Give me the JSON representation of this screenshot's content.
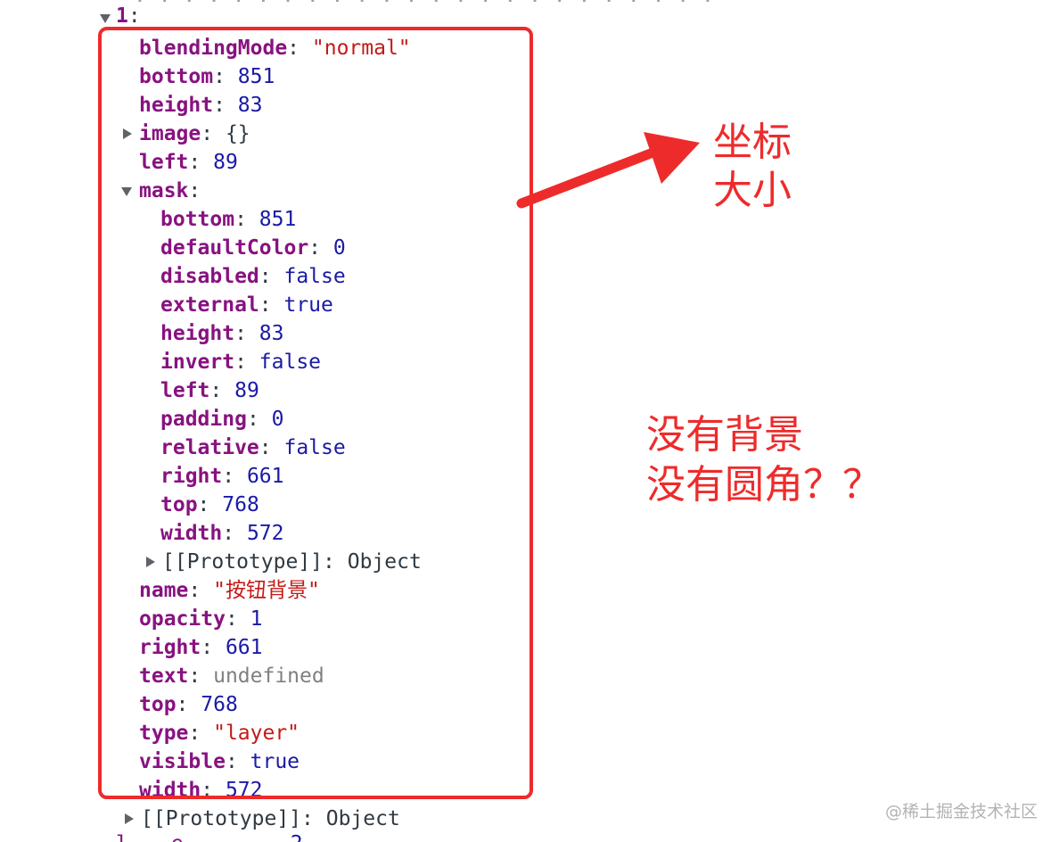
{
  "header_row": {
    "index": "1",
    "colon": ":"
  },
  "properties": [
    {
      "key": "blendingMode",
      "value": "\"normal\"",
      "kind": "str"
    },
    {
      "key": "bottom",
      "value": "851",
      "kind": "num"
    },
    {
      "key": "height",
      "value": "83",
      "kind": "num"
    },
    {
      "key": "image",
      "value": "{}",
      "kind": "plain",
      "expandable": true
    },
    {
      "key": "left",
      "value": "89",
      "kind": "num"
    },
    {
      "key": "mask",
      "value": "",
      "kind": "plain",
      "expanded": true
    }
  ],
  "mask_properties": [
    {
      "key": "bottom",
      "value": "851",
      "kind": "num"
    },
    {
      "key": "defaultColor",
      "value": "0",
      "kind": "num"
    },
    {
      "key": "disabled",
      "value": "false",
      "kind": "bool"
    },
    {
      "key": "external",
      "value": "true",
      "kind": "bool"
    },
    {
      "key": "height",
      "value": "83",
      "kind": "num"
    },
    {
      "key": "invert",
      "value": "false",
      "kind": "bool"
    },
    {
      "key": "left",
      "value": "89",
      "kind": "num"
    },
    {
      "key": "padding",
      "value": "0",
      "kind": "num"
    },
    {
      "key": "relative",
      "value": "false",
      "kind": "bool"
    },
    {
      "key": "right",
      "value": "661",
      "kind": "num"
    },
    {
      "key": "top",
      "value": "768",
      "kind": "num"
    },
    {
      "key": "width",
      "value": "572",
      "kind": "num"
    }
  ],
  "mask_prototype": {
    "label": "[[Prototype]]",
    "value": "Object"
  },
  "rest_properties": [
    {
      "key": "name",
      "value": "\"按钮背景\"",
      "kind": "str"
    },
    {
      "key": "opacity",
      "value": "1",
      "kind": "num"
    },
    {
      "key": "right",
      "value": "661",
      "kind": "num"
    },
    {
      "key": "text",
      "value": "undefined",
      "kind": "undef"
    },
    {
      "key": "top",
      "value": "768",
      "kind": "num"
    },
    {
      "key": "type",
      "value": "\"layer\"",
      "kind": "str"
    },
    {
      "key": "visible",
      "value": "true",
      "kind": "bool"
    },
    {
      "key": "width",
      "value": "572",
      "kind": "num"
    }
  ],
  "outer_prototype": {
    "label": "[[Prototype]]",
    "value": "Object"
  },
  "annotations": {
    "arrow_note_line1": "坐标",
    "arrow_note_line2": "大小",
    "question_line1": "没有背景",
    "question_line2": "没有圆角？？"
  },
  "watermark": "@稀土掘金技术社区",
  "colors": {
    "annotation_red": "#ee2b2b",
    "key_purple": "#881280",
    "string_red": "#c41a16",
    "number_blue": "#1a1aa6"
  }
}
